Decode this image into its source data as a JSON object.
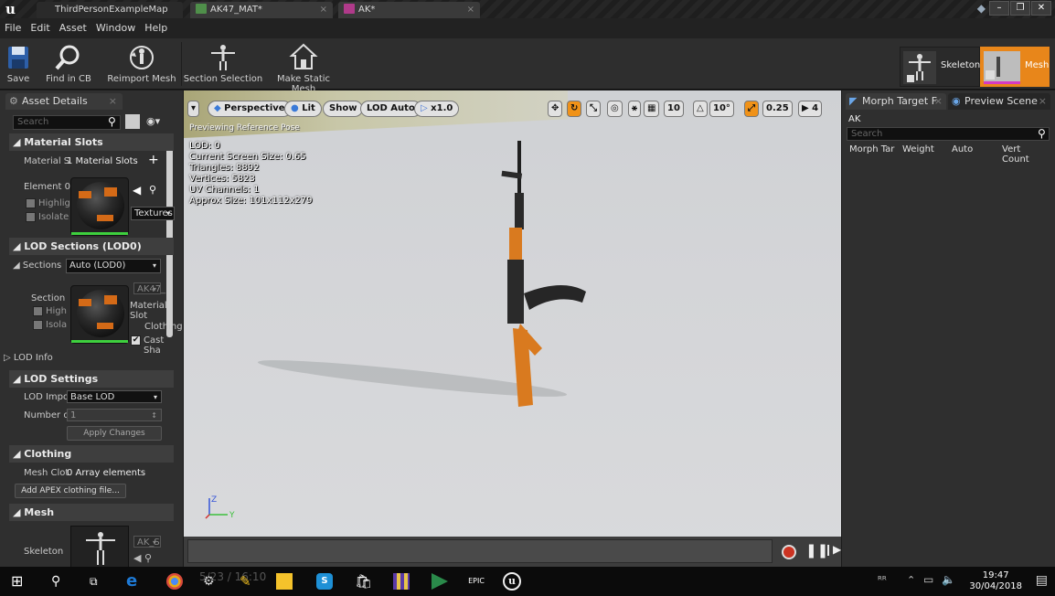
{
  "titlebar": {
    "tabs": [
      {
        "label": "ThirdPersonExampleMap"
      },
      {
        "label": "AK47_MAT*"
      },
      {
        "label": "AK*"
      }
    ],
    "logo": "u"
  },
  "menu": [
    "File",
    "Edit",
    "Asset",
    "Window",
    "Help"
  ],
  "toolbar": {
    "buttons": [
      {
        "label": "Save",
        "icon": "save-icon"
      },
      {
        "label": "Find in CB",
        "icon": "magnifier-icon"
      },
      {
        "label": "Reimport Mesh",
        "icon": "reimport-icon"
      },
      {
        "label": "Section Selection",
        "icon": "skeleton-figure-icon"
      },
      {
        "label": "Make Static Mesh",
        "icon": "house-icon"
      }
    ],
    "modes": [
      {
        "label": "Skeleton"
      },
      {
        "label": "Mesh"
      }
    ]
  },
  "left_panel": {
    "tab": "Asset Details",
    "search_placeholder": "Search",
    "material_slots": {
      "title": "Material Slots",
      "label": "Material S",
      "value": "1 Material Slots",
      "element_label": "Element 0",
      "highlight": "Highlig",
      "isolate": "Isolate",
      "textures": "Textures"
    },
    "lod_sections": {
      "title": "LOD Sections (LOD0)",
      "sections_label": "Sections",
      "sections_value": "Auto (LOD0)",
      "section_label": "Section",
      "high": "High",
      "isola": "Isola",
      "mat_combo": "AK47_",
      "material_slot": "Material Slot",
      "clothing": "Clothing",
      "cast_shadow": "Cast Sha",
      "lod_info": "LOD Info"
    },
    "lod_settings": {
      "title": "LOD Settings",
      "lod_import": "LOD Impor",
      "lod_import_value": "Base LOD",
      "number_of": "Number of",
      "number_value": "1",
      "apply": "Apply Changes"
    },
    "clothing": {
      "title": "Clothing",
      "mesh_cloth": "Mesh Clot",
      "mesh_cloth_value": "0 Array elements",
      "add_apex": "Add APEX clothing file..."
    },
    "mesh": {
      "title": "Mesh",
      "skeleton": "Skeleton",
      "skeleton_combo": "AK_S"
    }
  },
  "viewport": {
    "perspective": "Perspective",
    "lit": "Lit",
    "show": "Show",
    "lod": "LOD Auto",
    "speed": "x1.0",
    "grid_value": "10",
    "angle_value": "10°",
    "scale_value": "0.25",
    "camera_speed": "4",
    "previewing": "Previewing Reference Pose",
    "stats": {
      "lod": "LOD: 0",
      "screen_size": "Current Screen Size: 0.65",
      "triangles": "Triangles: 8892",
      "vertices": "Vertices: 5823",
      "uv": "UV Channels: 1",
      "approx": "Approx Size: 101x112x279"
    },
    "axis_z": "Z",
    "axis_y": "Y"
  },
  "right_panel": {
    "tabs": [
      {
        "label": "Morph Target F"
      },
      {
        "label": "Preview Scene"
      }
    ],
    "name": "AK",
    "search_placeholder": "Search",
    "columns": [
      "Morph Tar",
      "Weight",
      "Auto",
      "Vert Count"
    ]
  },
  "taskbar": {
    "time": "19:47",
    "date": "30/04/2018",
    "epic_label": "EPIC",
    "ghost_text": "5/23 / 16:10"
  },
  "colors": {
    "accent_orange": "#f09218",
    "wood": "#d4781e",
    "metal": "#2a2a2a"
  }
}
